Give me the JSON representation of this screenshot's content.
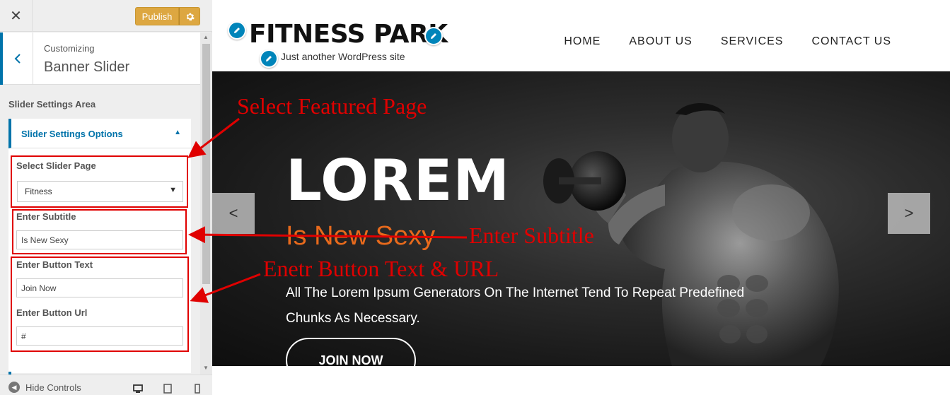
{
  "customizer": {
    "close_icon": "close-icon",
    "publish_label": "Publish",
    "breadcrumb_label": "Customizing",
    "section_title": "Banner Slider",
    "area_title": "Slider Settings Area",
    "panel_title": "Slider Settings Options",
    "controls": {
      "page_label": "Select Slider Page",
      "page_value": "Fitness",
      "subtitle_label": "Enter Subtitle",
      "subtitle_value": "Is New Sexy",
      "button_text_label": "Enter Button Text",
      "button_text_value": "Join Now",
      "button_url_label": "Enter Button Url",
      "button_url_value": "#"
    },
    "footer": {
      "hide_controls_label": "Hide Controls"
    }
  },
  "site": {
    "title": "FITNESS PARK",
    "tagline": "Just another WordPress site",
    "nav": [
      "HOME",
      "ABOUT US",
      "SERVICES",
      "CONTACT US"
    ]
  },
  "hero": {
    "title": "LOREM",
    "subtitle": "Is New Sexy",
    "description": "All The Lorem Ipsum Generators On The Internet Tend To Repeat Predefined Chunks As Necessary.",
    "button_label": "JOIN NOW",
    "prev_label": "<",
    "next_label": ">"
  },
  "annotations": {
    "featured_page": "Select Featured Page",
    "subtitle": "Enter Subtitle",
    "button": "Enetr  Button Text & URL",
    "color": "#e00000"
  },
  "colors": {
    "accent": "#0073aa",
    "publish": "#dda741",
    "subtitle_orange": "#e86a1c"
  }
}
